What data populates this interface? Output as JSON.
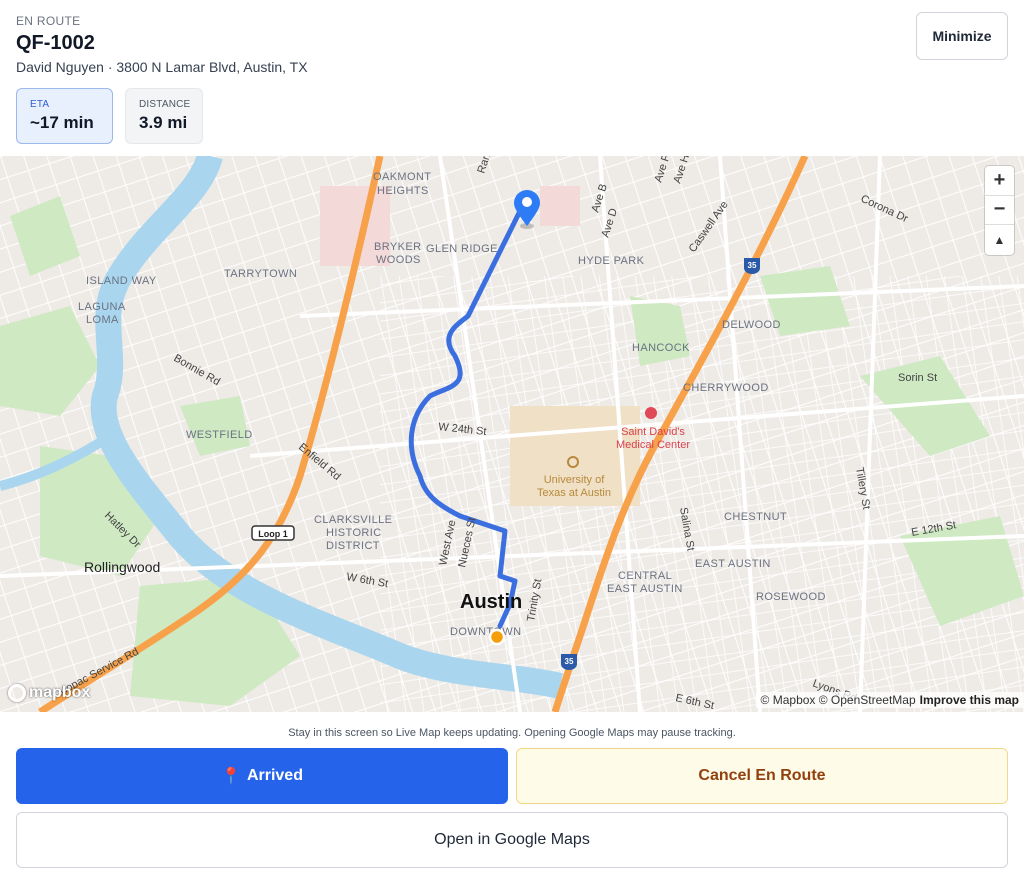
{
  "header": {
    "status": "EN ROUTE",
    "order_id": "QF-1002",
    "subtitle": "David Nguyen · 3800 N Lamar Blvd, Austin, TX",
    "minimize_label": "Minimize"
  },
  "stats": {
    "eta_label": "ETA",
    "eta_value": "~17 min",
    "distance_label": "DISTANCE",
    "distance_value": "3.9 mi"
  },
  "map": {
    "labels": {
      "oakmont_heights_1": "OAKMONT",
      "oakmont_heights_2": "HEIGHTS",
      "bryker_woods_1": "BRYKER",
      "bryker_woods_2": "WOODS",
      "glen_ridge": "GLEN RIDGE",
      "tarrytown": "TARRYTOWN",
      "island_way": "ISLAND WAY",
      "laguna_loma_1": "LAGUNA",
      "laguna_loma_2": "LOMA",
      "hyde_park": "HYDE PARK",
      "delwood": "DELWOOD",
      "hancock": "HANCOCK",
      "cherrywood": "CHERRYWOOD",
      "westfield": "WESTFIELD",
      "clarksville_1": "CLARKSVILLE",
      "clarksville_2": "HISTORIC",
      "clarksville_3": "DISTRICT",
      "rollingwood": "Rollingwood",
      "austin": "Austin",
      "downtown": "DOWNTOWN",
      "chestnut": "CHESTNUT",
      "central_east_1": "CENTRAL",
      "central_east_2": "EAST AUSTIN",
      "east_austin": "EAST AUSTIN",
      "rosewood": "ROSEWOOD",
      "ut_1": "University of",
      "ut_2": "Texas at Austin",
      "st_davids_1": "Saint David's",
      "st_davids_2": "Medical Center",
      "w24th": "W 24th St",
      "w6th": "W 6th St",
      "e12th": "E 12th St",
      "e6th": "E 6th St",
      "enfield": "Enfield Rd",
      "bonnie": "Bonnie Rd",
      "hatley": "Hatley Dr",
      "pacsvc": "Mopac Service Rd",
      "loop1": "Loop 1",
      "i35": "35",
      "sorin": "Sorin St",
      "corona": "Corona Dr",
      "tillery": "Tillery St",
      "salina": "Salina St",
      "trinity": "Trinity St",
      "west_ave": "West Ave",
      "nueces": "Nueces St",
      "lyons": "Lyons Rd",
      "ave_b": "Ave B",
      "ave_d": "Ave D",
      "ave_f": "Ave F",
      "ave_h": "Ave H",
      "caswell": "Caswell Ave",
      "ran": "Ran"
    },
    "zoom_in": "+",
    "zoom_out": "−",
    "compass": "▲",
    "logo": "mapbox",
    "attribution": "© Mapbox © OpenStreetMap",
    "improve": "Improve this map",
    "colors": {
      "route": "#3b6fe0",
      "highway": "#f7a24a",
      "water": "#a9d6ee",
      "park": "#cfe9c3",
      "driver": "#f59e0b",
      "pin": "#2e7bf6"
    }
  },
  "footer": {
    "note": "Stay in this screen so Live Map keeps updating. Opening Google Maps may pause tracking.",
    "arrived_icon": "📍",
    "arrived_label": "Arrived",
    "cancel_label": "Cancel En Route",
    "gmaps_label": "Open in Google Maps"
  }
}
